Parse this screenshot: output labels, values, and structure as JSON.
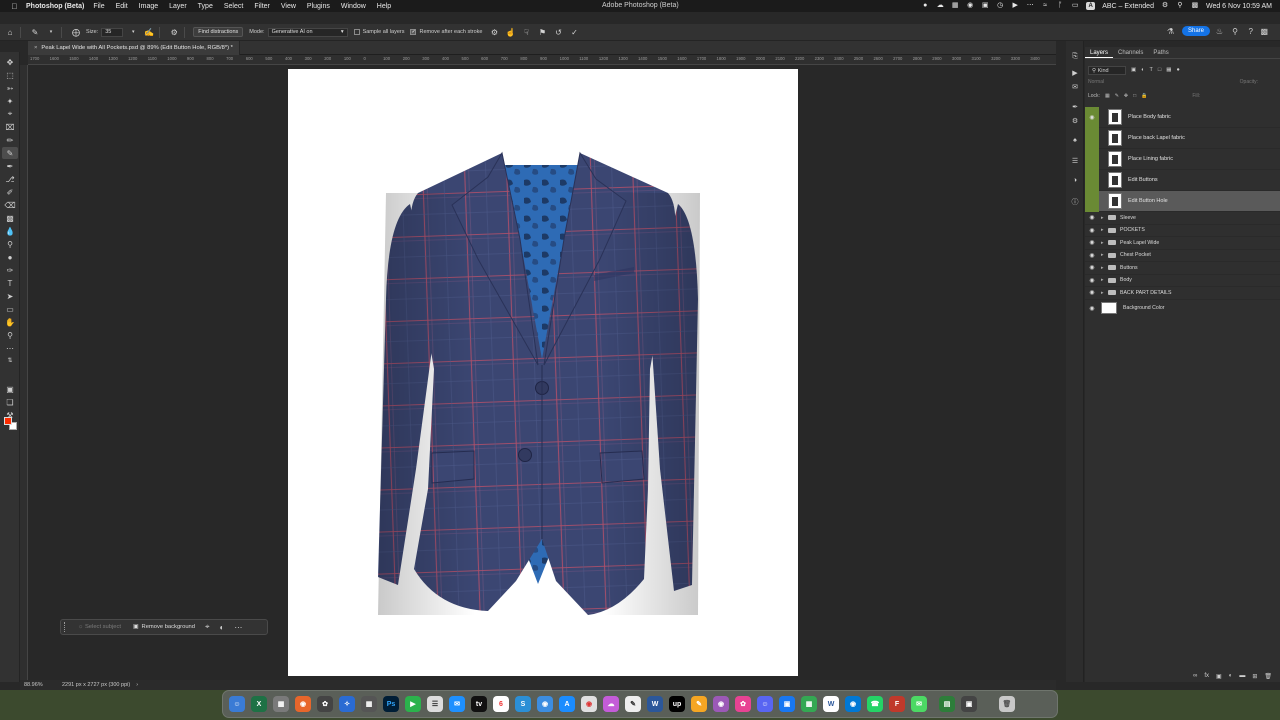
{
  "menubar": {
    "app_name": "Photoshop (Beta)",
    "menus": [
      "File",
      "Edit",
      "Image",
      "Layer",
      "Type",
      "Select",
      "Filter",
      "View",
      "Plugins",
      "Window",
      "Help"
    ],
    "window_title": "Adobe Photoshop (Beta)",
    "input_source": "ABC – Extended",
    "datetime": "Wed 6 Nov  10:59 AM"
  },
  "options": {
    "size_label": "Size:",
    "size_value": "35",
    "find_distractions": "Find distractions",
    "mode_label": "Mode:",
    "mode_value": "Generative AI on",
    "sample_all_layers": "Sample all layers",
    "remove_after_stroke": "Remove after each stroke",
    "share": "Share"
  },
  "document": {
    "tab_title": "Peak Lapel Wide with All Pockets.psd @ 89% (Edit Button Hole, RGB/8*) *"
  },
  "ruler": {
    "ticks": [
      "1700",
      "1600",
      "1500",
      "1400",
      "1300",
      "1200",
      "1100",
      "1000",
      "900",
      "800",
      "700",
      "600",
      "500",
      "400",
      "300",
      "200",
      "100",
      "0",
      "100",
      "200",
      "300",
      "400",
      "500",
      "600",
      "700",
      "800",
      "900",
      "1000",
      "1100",
      "1200",
      "1300",
      "1400",
      "1500",
      "1600",
      "1700",
      "1800",
      "1900",
      "2000",
      "2100",
      "2200",
      "2300",
      "2400",
      "2500",
      "2600",
      "2700",
      "2800",
      "2900",
      "3000",
      "3100",
      "3200",
      "3300",
      "3400"
    ]
  },
  "contextbar": {
    "select_subject": "Select subject",
    "remove_background": "Remove background"
  },
  "status": {
    "zoom": "88.96%",
    "dimensions": "2291 px x 2727 px (300 ppi)"
  },
  "layers_panel": {
    "tabs": [
      "Layers",
      "Channels",
      "Paths"
    ],
    "kind": "Kind",
    "blend_mode": "Normal",
    "opacity_label": "Opacity:",
    "lock_label": "Lock:",
    "fill_label": "Fill:",
    "smart_layers": [
      {
        "name": "Place Body fabric",
        "selected": false
      },
      {
        "name": "Place back Lapel fabric",
        "selected": false
      },
      {
        "name": "Place Lining fabric",
        "selected": false
      },
      {
        "name": "Edit Buttons",
        "selected": false
      },
      {
        "name": "Edit Button Hole",
        "selected": true
      }
    ],
    "groups": [
      "Sleeve",
      "POCKETS",
      "Peak Lapel Wide",
      "Chest Pocket",
      "Buttons",
      "Body",
      "BACK PART DETAILS"
    ],
    "background_layer": "Background Color"
  },
  "colors": {
    "foreground": "#ff2c00",
    "background": "#ffffff",
    "accent": "#1473e6",
    "suit_fabric": "#3b4672",
    "suit_check_lines": "#b0506a",
    "lining": "#2e6bb5"
  }
}
